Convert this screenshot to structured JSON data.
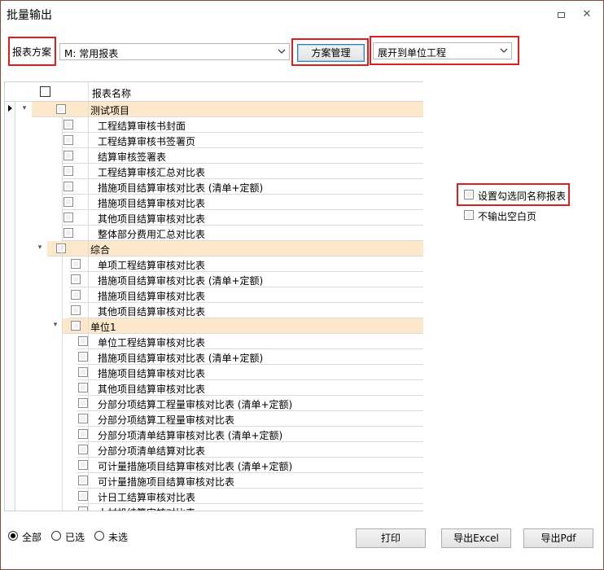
{
  "window": {
    "title": "批量输出",
    "restore_label": "",
    "close_label": "✕"
  },
  "toolbar": {
    "scheme_label": "报表方案",
    "scheme_value": "M: 常用报表",
    "manage_button": "方案管理",
    "expand_value": "展开到单位工程"
  },
  "grid": {
    "header_name": "报表名称",
    "rows": [
      {
        "label": "测试项目",
        "kind": "group",
        "level": 0,
        "current": true
      },
      {
        "label": "工程结算审核书封面",
        "kind": "item",
        "level": 1
      },
      {
        "label": "工程结算审核书签署页",
        "kind": "item",
        "level": 1
      },
      {
        "label": "结算审核签署表",
        "kind": "item",
        "level": 1
      },
      {
        "label": "工程结算审核汇总对比表",
        "kind": "item",
        "level": 1
      },
      {
        "label": "措施项目结算审核对比表 (清单+定额)",
        "kind": "item",
        "level": 1
      },
      {
        "label": "措施项目结算审核对比表",
        "kind": "item",
        "level": 1
      },
      {
        "label": "其他项目结算审核对比表",
        "kind": "item",
        "level": 1
      },
      {
        "label": "整体部分费用汇总对比表",
        "kind": "item",
        "level": 1
      },
      {
        "label": "综合",
        "kind": "group",
        "level": 1
      },
      {
        "label": "单项工程结算审核对比表",
        "kind": "item",
        "level": 2
      },
      {
        "label": "措施项目结算审核对比表 (清单+定额)",
        "kind": "item",
        "level": 2
      },
      {
        "label": "措施项目结算审核对比表",
        "kind": "item",
        "level": 2
      },
      {
        "label": "其他项目结算审核对比表",
        "kind": "item",
        "level": 2
      },
      {
        "label": "单位1",
        "kind": "group",
        "level": 2
      },
      {
        "label": "单位工程结算审核对比表",
        "kind": "item",
        "level": 3
      },
      {
        "label": "措施项目结算审核对比表 (清单+定额)",
        "kind": "item",
        "level": 3
      },
      {
        "label": "措施项目结算审核对比表",
        "kind": "item",
        "level": 3
      },
      {
        "label": "其他项目结算审核对比表",
        "kind": "item",
        "level": 3
      },
      {
        "label": "分部分项结算工程量审核对比表 (清单+定额)",
        "kind": "item",
        "level": 3
      },
      {
        "label": "分部分项结算工程量审核对比表",
        "kind": "item",
        "level": 3
      },
      {
        "label": "分部分项清单结算审核对比表 (清单+定额)",
        "kind": "item",
        "level": 3
      },
      {
        "label": "分部分项清单结算对比表",
        "kind": "item",
        "level": 3
      },
      {
        "label": "可计量措施项目结算审核对比表 (清单+定额)",
        "kind": "item",
        "level": 3
      },
      {
        "label": "可计量措施项目结算审核对比表",
        "kind": "item",
        "level": 3
      },
      {
        "label": "计日工结算审核对比表",
        "kind": "item",
        "level": 3
      },
      {
        "label": "人材机结算审核对比表",
        "kind": "item",
        "level": 3
      }
    ]
  },
  "options": {
    "same_name_label": "设置勾选同名称报表",
    "no_blank_label": "不输出空白页"
  },
  "filter": {
    "all": "全部",
    "selected": "已选",
    "unselected": "未选"
  },
  "buttons": {
    "print": "打印",
    "export_excel": "导出Excel",
    "export_pdf": "导出Pdf"
  }
}
